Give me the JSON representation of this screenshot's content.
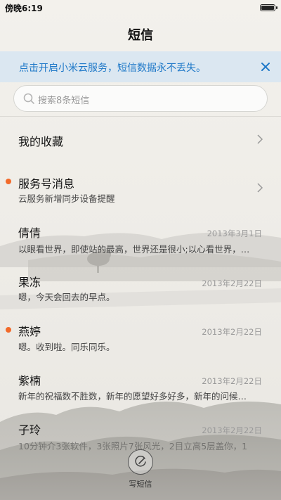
{
  "status": {
    "time": "傍晚6:19",
    "battery_level": 1.0
  },
  "header": {
    "title": "短信"
  },
  "banner": {
    "text": "点击开启小米云服务，短信数据永不丢失。",
    "close_icon": "close-icon"
  },
  "search": {
    "placeholder": "搜索8条短信",
    "icon": "search-icon"
  },
  "conversations": [
    {
      "title": "我的收藏",
      "subtitle": "",
      "date": "",
      "unread": false,
      "chevron": true
    },
    {
      "title": "服务号消息",
      "subtitle": "云服务新增同步设备提醒",
      "date": "",
      "unread": true,
      "chevron": true
    },
    {
      "title": "倩倩",
      "subtitle": "以眼看世界，即使站的最高，世界还是很小;以心看世界，…",
      "date": "2013年3月1日",
      "unread": false,
      "chevron": false
    },
    {
      "title": "果冻",
      "subtitle": "嗯，今天会回去的早点。",
      "date": "2013年2月22日",
      "unread": false,
      "chevron": false
    },
    {
      "title": "燕婷",
      "subtitle": "嗯。收到啦。同乐同乐。",
      "date": "2013年2月22日",
      "unread": true,
      "chevron": false
    },
    {
      "title": "紫楠",
      "subtitle": "新年的祝福数不胜数，新年的愿望好多好多，新年的问候…",
      "date": "2013年2月22日",
      "unread": false,
      "chevron": false
    },
    {
      "title": "子玲",
      "subtitle": "10分钟介3张软件，3张照片7张风光，2目立高5层盖你，1",
      "date": "2013年2月22日",
      "unread": false,
      "chevron": false
    }
  ],
  "compose": {
    "label": "写短信",
    "icon": "compose-pen-icon"
  },
  "colors": {
    "accent": "#1e78c8",
    "unread": "#f26a2a",
    "banner_bg": "#dbe7f1"
  }
}
